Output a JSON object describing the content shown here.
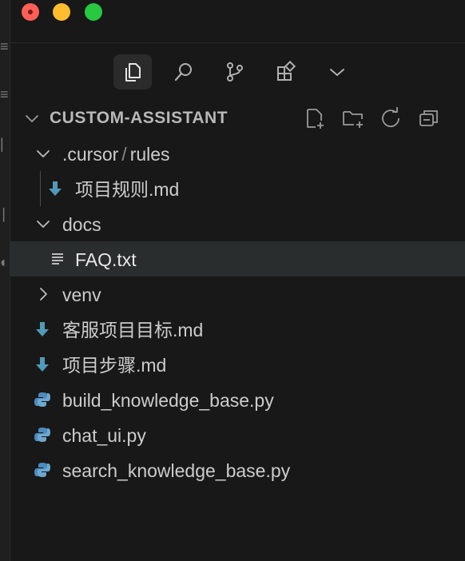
{
  "window": {
    "controls": [
      "close",
      "minimize",
      "maximize"
    ]
  },
  "activity_tabs": [
    {
      "name": "explorer",
      "icon": "files-icon",
      "active": true
    },
    {
      "name": "search",
      "icon": "search-icon",
      "active": false
    },
    {
      "name": "source-control",
      "icon": "source-control-icon",
      "active": false
    },
    {
      "name": "extensions",
      "icon": "extensions-icon",
      "active": false
    },
    {
      "name": "more",
      "icon": "chevron-down-icon",
      "active": false
    }
  ],
  "explorer": {
    "section_title": "CUSTOM-ASSISTANT",
    "actions": [
      "new-file-icon",
      "new-folder-icon",
      "refresh-icon",
      "collapse-all-icon"
    ],
    "tree": {
      "cursor_folder": {
        "name": ".cursor",
        "sub": "rules",
        "expanded": true
      },
      "rule_file": {
        "name": "项目规则.md",
        "icon": "markdown-icon"
      },
      "docs_folder": {
        "name": "docs",
        "expanded": true
      },
      "faq_file": {
        "name": "FAQ.txt",
        "icon": "text-file-icon",
        "selected": true
      },
      "venv_folder": {
        "name": "venv",
        "expanded": false
      },
      "file_goal": {
        "name": "客服项目目标.md",
        "icon": "markdown-icon"
      },
      "file_steps": {
        "name": "项目步骤.md",
        "icon": "markdown-icon"
      },
      "file_build": {
        "name": "build_knowledge_base.py",
        "icon": "python-icon"
      },
      "file_chat": {
        "name": "chat_ui.py",
        "icon": "python-icon"
      },
      "file_search": {
        "name": "search_knowledge_base.py",
        "icon": "python-icon"
      }
    }
  },
  "colors": {
    "background": "#181818",
    "selected_row": "#2a2d2e",
    "text": "#cccccc",
    "markdown_icon": "#519aba",
    "python_icon_blue": "#4b8bbe",
    "python_icon_yellow": "#ffd43b"
  }
}
